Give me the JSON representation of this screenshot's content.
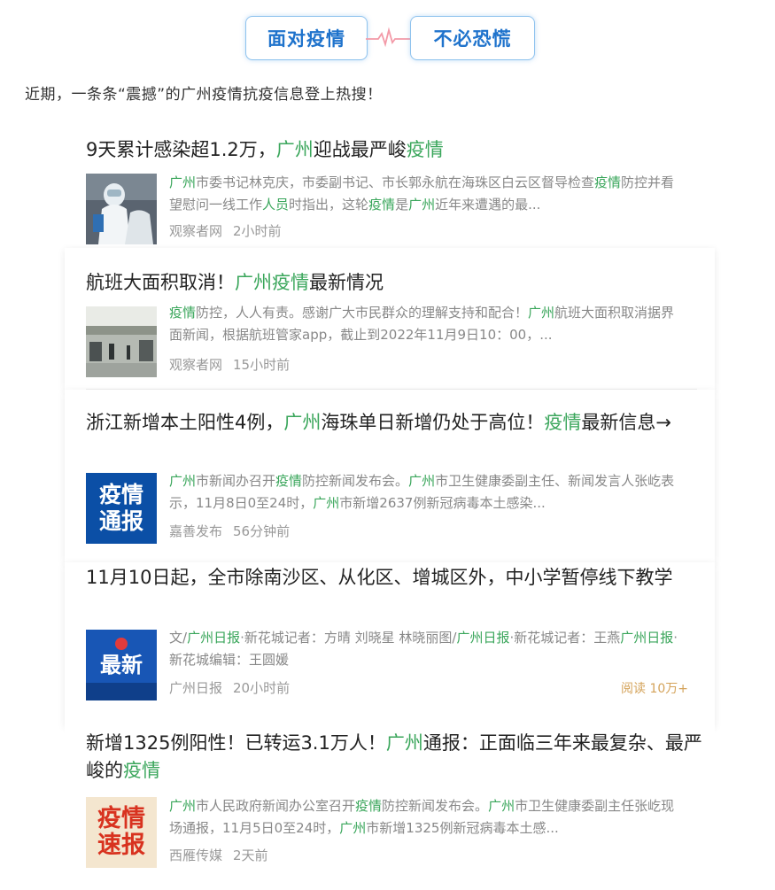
{
  "header": {
    "left_label": "面对疫情",
    "right_label": "不必恐慌"
  },
  "intro_text": "近期，一条条“震撼”的广州疫情抗疫信息登上热搜！",
  "colors": {
    "highlight": "#3aa65b",
    "pill_text": "#1f73cc",
    "meta": "#999999",
    "read_count": "#d4a35a"
  },
  "articles": [
    {
      "title": [
        {
          "t": "9天累计感染超1.2万，"
        },
        {
          "t": "广州",
          "hl": true
        },
        {
          "t": "迎战最严峻"
        },
        {
          "t": "疫情",
          "hl": true
        }
      ],
      "snippet": [
        {
          "t": "广州",
          "hl": true
        },
        {
          "t": "市委书记林克庆，市委副书记、市长郭永航在海珠区白云区督导检查"
        },
        {
          "t": "疫情",
          "hl": true
        },
        {
          "t": "防控并看望慰问一线工作"
        },
        {
          "t": "人员",
          "hl": true
        },
        {
          "t": "时指出，这轮"
        },
        {
          "t": "疫情",
          "hl": true
        },
        {
          "t": "是"
        },
        {
          "t": "广州",
          "hl": true
        },
        {
          "t": "近年来遭遇的最..."
        }
      ],
      "source": "观察者网",
      "time": "2小时前",
      "thumb": "photo-protective-suit"
    },
    {
      "title": [
        {
          "t": "航班大面积取消！"
        },
        {
          "t": "广州疫情",
          "hl": true
        },
        {
          "t": "最新情况"
        }
      ],
      "snippet": [
        {
          "t": "疫情",
          "hl": true
        },
        {
          "t": "防控，人人有责。感谢广大市民群众的理解支持和配合！"
        },
        {
          "t": "广州",
          "hl": true
        },
        {
          "t": "航班大面积取消据界面新闻，根据航班管家app，截止到2022年11月9日10：00，..."
        }
      ],
      "source": "观察者网",
      "time": "15小时前",
      "thumb": "photo-airport-hall"
    },
    {
      "title": [
        {
          "t": "浙江新增本土阳性4例，"
        },
        {
          "t": "广州",
          "hl": true
        },
        {
          "t": "海珠单日新增仍处于高位！"
        },
        {
          "t": "疫情",
          "hl": true
        },
        {
          "t": "最新信息→"
        }
      ],
      "snippet": [
        {
          "t": "广州",
          "hl": true
        },
        {
          "t": "市新闻办召开"
        },
        {
          "t": "疫情",
          "hl": true
        },
        {
          "t": "防控新闻发布会。"
        },
        {
          "t": "广州",
          "hl": true
        },
        {
          "t": "市卫生健康委副主任、新闻发言人张屹表示，11月8日0至24时，"
        },
        {
          "t": "广州",
          "hl": true
        },
        {
          "t": "市新增2637例新冠病毒本土感染..."
        }
      ],
      "source": "嘉善发布",
      "time": "56分钟前",
      "thumb": "badge-yiqing-tongbao",
      "thumb_text": [
        "疫情",
        "通报"
      ]
    },
    {
      "title": [
        {
          "t": "11月10日起，全市除南沙区、从化区、增城区外，中小学暂停线下教学"
        }
      ],
      "snippet": [
        {
          "t": "文/"
        },
        {
          "t": "广州日报",
          "hl": true
        },
        {
          "t": "·新花城记者：方晴 刘晓星 林晓丽图/"
        },
        {
          "t": "广州日报",
          "hl": true
        },
        {
          "t": "·新花城记者：王燕"
        },
        {
          "t": "广州日报",
          "hl": true
        },
        {
          "t": "·新花城编辑：王圆媛"
        }
      ],
      "source": "广州日报",
      "time": "20小时前",
      "read_count": "阅读 10万+",
      "thumb": "badge-zuixin",
      "thumb_text": [
        "最新"
      ]
    },
    {
      "title": [
        {
          "t": "新增1325例阳性！已转运3.1万人！"
        },
        {
          "t": "广州",
          "hl": true
        },
        {
          "t": "通报：正面临三年来最复杂、最严峻的"
        },
        {
          "t": "疫情",
          "hl": true
        }
      ],
      "snippet": [
        {
          "t": "广州",
          "hl": true
        },
        {
          "t": "市人民政府新闻办公室召开"
        },
        {
          "t": "疫情",
          "hl": true
        },
        {
          "t": "防控新闻发布会。"
        },
        {
          "t": "广州",
          "hl": true
        },
        {
          "t": "市卫生健康委副主任张屹现场通报，11月5日0至24时，"
        },
        {
          "t": "广州",
          "hl": true
        },
        {
          "t": "市新增1325例新冠病毒本土感..."
        }
      ],
      "source": "西雁传媒",
      "time": "2天前",
      "thumb": "badge-yiqing-subao",
      "thumb_text": [
        "疫情",
        "速报"
      ]
    }
  ]
}
